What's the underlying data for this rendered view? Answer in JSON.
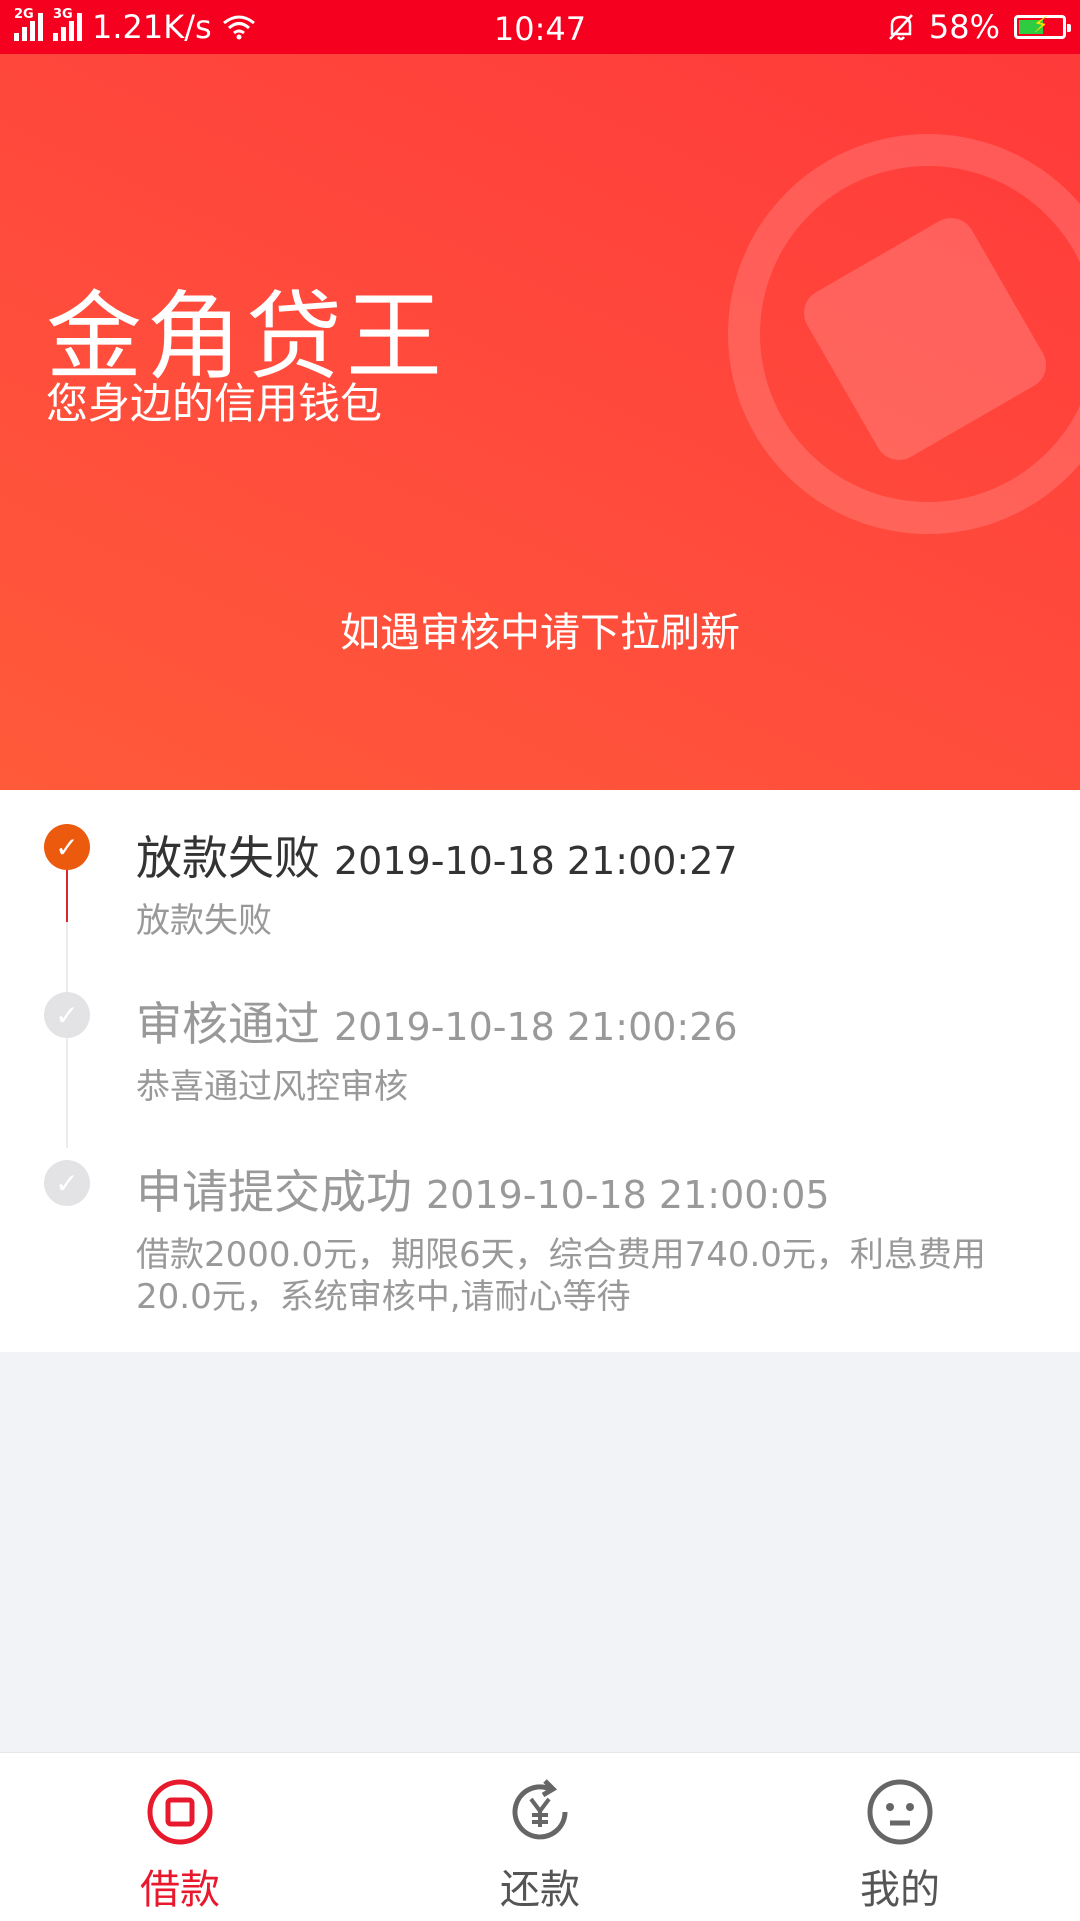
{
  "status_bar": {
    "net1": "2G",
    "net2": "3G",
    "speed": "1.21K/s",
    "time": "10:47",
    "battery": "58%",
    "battery_level": 0.58
  },
  "hero": {
    "title": "金角贷王",
    "subtitle": "您身边的信用钱包",
    "hint": "如遇审核中请下拉刷新"
  },
  "timeline": [
    {
      "status": "放款失败",
      "time": "2019-10-18 21:00:27",
      "desc": "放款失败",
      "active": true
    },
    {
      "status": "审核通过",
      "time": "2019-10-18 21:00:26",
      "desc": "恭喜通过风控审核",
      "active": false
    },
    {
      "status": "申请提交成功",
      "time": "2019-10-18 21:00:05",
      "desc": "借款2000.0元，期限6天，综合费用740.0元，利息费用20.0元，系统审核中,请耐心等待",
      "active": false
    }
  ],
  "tabs": [
    {
      "label": "借款",
      "icon": "borrow-icon",
      "active": true
    },
    {
      "label": "还款",
      "icon": "repay-icon",
      "active": false
    },
    {
      "label": "我的",
      "icon": "profile-icon",
      "active": false
    }
  ],
  "colors": {
    "status_bar": "#f5001e",
    "accent": "#e8192c",
    "active_dot": "#ec5a0e",
    "inactive": "#999999"
  }
}
